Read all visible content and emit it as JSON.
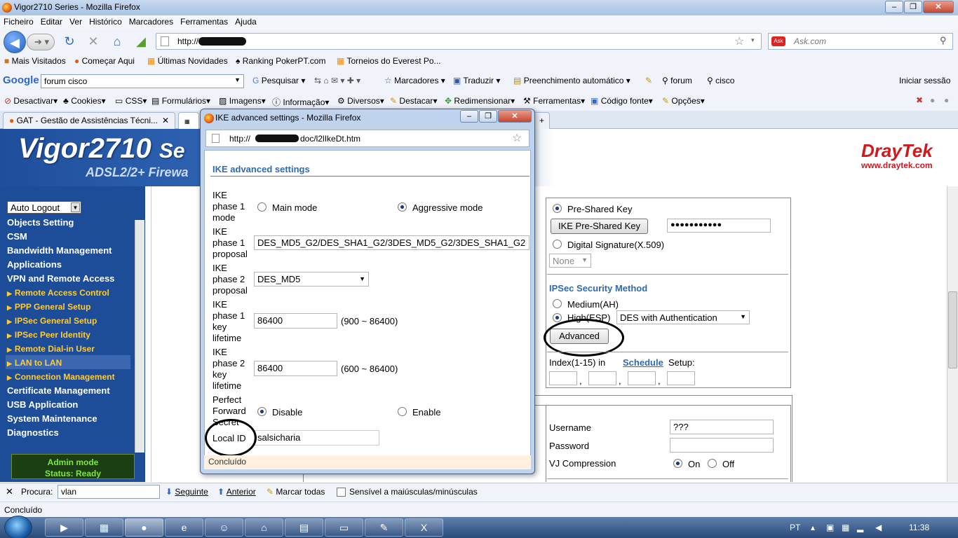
{
  "browser": {
    "window_title": "Vigor2710 Series - Mozilla Firefox",
    "menu": [
      "Ficheiro",
      "Editar",
      "Ver",
      "Histórico",
      "Marcadores",
      "Ferramentas",
      "Ajuda"
    ],
    "url": "http://",
    "search_engine": "Ask.com",
    "bookmarks": [
      "Mais Visitados",
      "Começar Aqui",
      "Últimas Novidades",
      "Ranking PokerPT.com",
      "Torneios do Everest Po..."
    ],
    "google": {
      "logo": "Google",
      "query": "forum cisco",
      "pesquisar": "Pesquisar",
      "marcadores": "Marcadores",
      "traduzir": "Traduzir",
      "preenchimento": "Preenchimento automático",
      "forum": "forum",
      "cisco": "cisco",
      "iniciar": "Iniciar sessão"
    },
    "webdev": [
      "Desactivar",
      "Cookies",
      "CSS",
      "Formulários",
      "Imagens",
      "Informação",
      "Diversos",
      "Destacar",
      "Redimensionar",
      "Ferramentas",
      "Código fonte",
      "Opções"
    ],
    "tabs": [
      {
        "label": "GAT - Gestão de Assistências Técni..."
      },
      {
        "label": ""
      }
    ],
    "status_text": "Concluído"
  },
  "router": {
    "logo_main": "Vigor2710",
    "logo_suffix": "Se",
    "logo_sub": "ADSL2/2+ Firewa",
    "brand": "DrayTek",
    "brand_url": "www.draytek.com",
    "auto_logout": "Auto Logout",
    "menu": [
      "Objects Setting",
      "CSM",
      "Bandwidth Management",
      "Applications",
      "VPN and Remote Access"
    ],
    "submenu": [
      "Remote Access Control",
      "PPP General Setup",
      "IPSec General Setup",
      "IPSec Peer Identity",
      "Remote Dial-in User",
      "LAN to LAN",
      "Connection Management"
    ],
    "menu2": [
      "Certificate Management",
      "USB Application",
      "System Maintenance",
      "Diagnostics"
    ],
    "status_line1": "Admin mode",
    "status_line2": "Status: Ready",
    "main": {
      "pre_shared_key": "Pre-Shared Key",
      "ike_psk_button": "IKE Pre-Shared Key",
      "psk_value": "●●●●●●●●●●●",
      "digital_signature": "Digital Signature(X.509)",
      "none_select": "None",
      "ipsec_method_title": "IPSec Security Method",
      "medium_ah": "Medium(AH)",
      "high_esp": "High(ESP)",
      "esp_select": "DES with Authentication",
      "advanced_button": "Advanced",
      "index_label": "Index(1-15) in",
      "schedule_link": "Schedule",
      "setup_label": "Setup:",
      "comma": ",",
      "username_label": "Username",
      "username_value": "???",
      "password_label": "Password",
      "vj_label": "VJ Compression",
      "on": "On",
      "off": "Off"
    }
  },
  "popup": {
    "title": "IKE advanced settings - Mozilla Firefox",
    "url": "http://",
    "url_path": "doc/l2lIkeDt.htm",
    "heading": "IKE advanced settings",
    "phase1_mode_label": [
      "IKE",
      "phase 1",
      "mode"
    ],
    "main_mode": "Main mode",
    "aggressive_mode": "Aggressive mode",
    "phase1_proposal_label": [
      "IKE",
      "phase 1",
      "proposal"
    ],
    "phase1_proposal_value": "DES_MD5_G2/DES_SHA1_G2/3DES_MD5_G2/3DES_SHA1_G2",
    "phase2_proposal_label": [
      "IKE",
      "phase 2",
      "proposal"
    ],
    "phase2_proposal_value": "DES_MD5",
    "phase1_lifetime_label": [
      "IKE",
      "phase 1",
      "key",
      "lifetime"
    ],
    "phase1_lifetime_value": "86400",
    "phase1_lifetime_range": "(900 ~ 86400)",
    "phase2_lifetime_label": [
      "IKE",
      "phase 2",
      "key",
      "lifetime"
    ],
    "phase2_lifetime_value": "86400",
    "phase2_lifetime_range": "(600 ~ 86400)",
    "pfs_label": [
      "Perfect",
      "Forward",
      "Secret"
    ],
    "disable": "Disable",
    "enable": "Enable",
    "local_id_label": "Local ID",
    "local_id_value": "salsicharia",
    "status": "Concluído"
  },
  "findbar": {
    "label": "Procura:",
    "value": "vlan",
    "next": "Seguinte",
    "prev": "Anterior",
    "highlight": "Marcar todas",
    "case": "Sensível a maiúsculas/minúsculas"
  },
  "taskbar": {
    "lang": "PT",
    "time": "11:38"
  }
}
